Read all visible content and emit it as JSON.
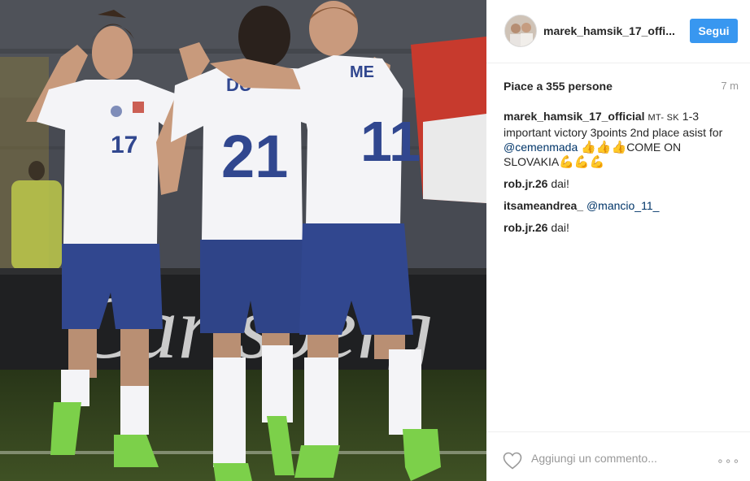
{
  "post": {
    "username": "marek_hamsik_17_offi...",
    "follow_label": "Segui",
    "likes_text": "Piace a 355 persone",
    "time_ago": "7 m",
    "caption": {
      "author": "marek_hamsik_17_official",
      "score_prefix": "MT- SK",
      "text_a": " 1-3 important victory 3points 2nd place asist for ",
      "mention": "@cemenmada",
      "emoji_a": "👍👍👍",
      "text_b": "COME ON SLOVAKIA",
      "emoji_b": "💪💪💪"
    },
    "comments": [
      {
        "author": "rob.jr.26",
        "text": "dai!"
      },
      {
        "author": "itsameandrea_",
        "mention": "@mancio_11_"
      },
      {
        "author": "rob.jr.26",
        "text": "dai!"
      }
    ],
    "comment_placeholder": "Aggiungi un commento...",
    "more_label": "∘∘∘"
  },
  "photo": {
    "jersey_numbers": {
      "left": "17",
      "center": "21",
      "right": "11"
    },
    "center_name": "DU",
    "right_name": "ME"
  },
  "colors": {
    "follow_button": "#3897f0",
    "mention": "#003569",
    "jersey": "#f4f4f7",
    "shorts": "#31478f",
    "boots": "#7cd04a"
  }
}
